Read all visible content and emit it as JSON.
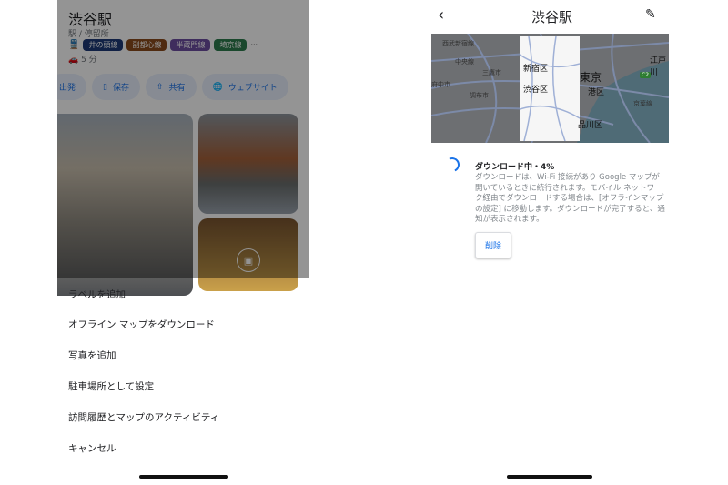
{
  "left": {
    "place_title": "渋谷駅",
    "category": "駅 / 停留所",
    "lines": [
      {
        "label": "井の頭線",
        "color": "#1e3a78"
      },
      {
        "label": "副都心線",
        "color": "#8a4a1c"
      },
      {
        "label": "半蔵門線",
        "color": "#6d4fa0"
      },
      {
        "label": "埼京線",
        "color": "#2e7d4f"
      }
    ],
    "more": "···",
    "drive_time": "5 分",
    "actions": [
      "出発",
      "保存",
      "共有",
      "ウェブサイト"
    ],
    "menu": [
      "ラベルを追加",
      "オフライン マップをダウンロード",
      "写真を追加",
      "駐車場所として設定",
      "訪問履歴とマップのアクティビティ",
      "キャンセル"
    ]
  },
  "right": {
    "title": "渋谷駅",
    "map_labels": [
      "西武新宿線",
      "中央線",
      "三鷹市",
      "府中市",
      "調布市",
      "新宿区",
      "渋谷区",
      "東京",
      "港区",
      "品川区",
      "江戸川",
      "京葉線",
      "C2"
    ],
    "download_status": "ダウンロード中・4%",
    "download_progress_percent": 4,
    "download_body": "ダウンロードは、Wi-Fi 接続があり Google マップが開いているときに続行されます。モバイル ネットワーク経由でダウンロードする場合は、[オフラインマップの設定] に移動します。ダウンロードが完了すると、通知が表示されます。",
    "delete_label": "削除"
  }
}
